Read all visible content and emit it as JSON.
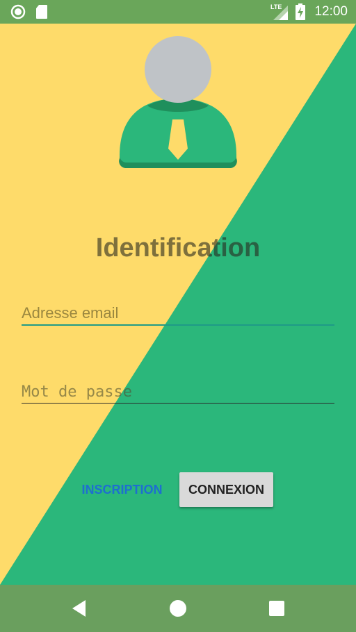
{
  "status_bar": {
    "time": "12:00",
    "network": "LTE",
    "icons": [
      "circle-app-icon",
      "sd-card-icon",
      "signal-icon",
      "battery-charging-icon"
    ]
  },
  "colors": {
    "yellow": "#FEDB6A",
    "green": "#2BB77B",
    "status_bar": "#6AA65A",
    "nav_bar": "#6A9F5E",
    "accent": "#1F9A87",
    "link_blue": "#1E6FD0"
  },
  "avatar": {
    "icon": "user-avatar-icon"
  },
  "login": {
    "title": "Identification",
    "email_placeholder": "Adresse email",
    "password_placeholder": "Mot de passe",
    "inscription_label": "INSCRIPTION",
    "connexion_label": "CONNEXION"
  },
  "nav_bar": {
    "icons": [
      "back-icon",
      "home-icon",
      "recents-icon"
    ]
  }
}
